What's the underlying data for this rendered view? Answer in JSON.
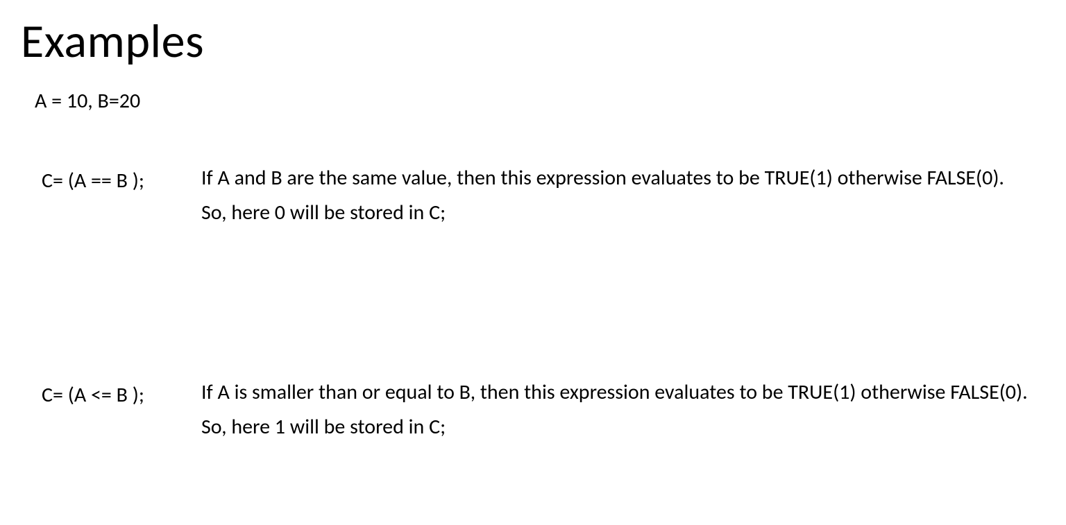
{
  "title": "Examples",
  "init": "A = 10, B=20",
  "examples": [
    {
      "expression": "C=  (A == B );",
      "explanation": "If A and B are the same value, then this expression evaluates to be TRUE(1) otherwise FALSE(0).  So, here 0 will be stored in C;"
    },
    {
      "expression": "C=  (A <= B );",
      "explanation": "If A  is smaller than or equal to B, then this expression evaluates to be TRUE(1) otherwise FALSE(0).  So, here 1 will be stored in C;"
    }
  ]
}
